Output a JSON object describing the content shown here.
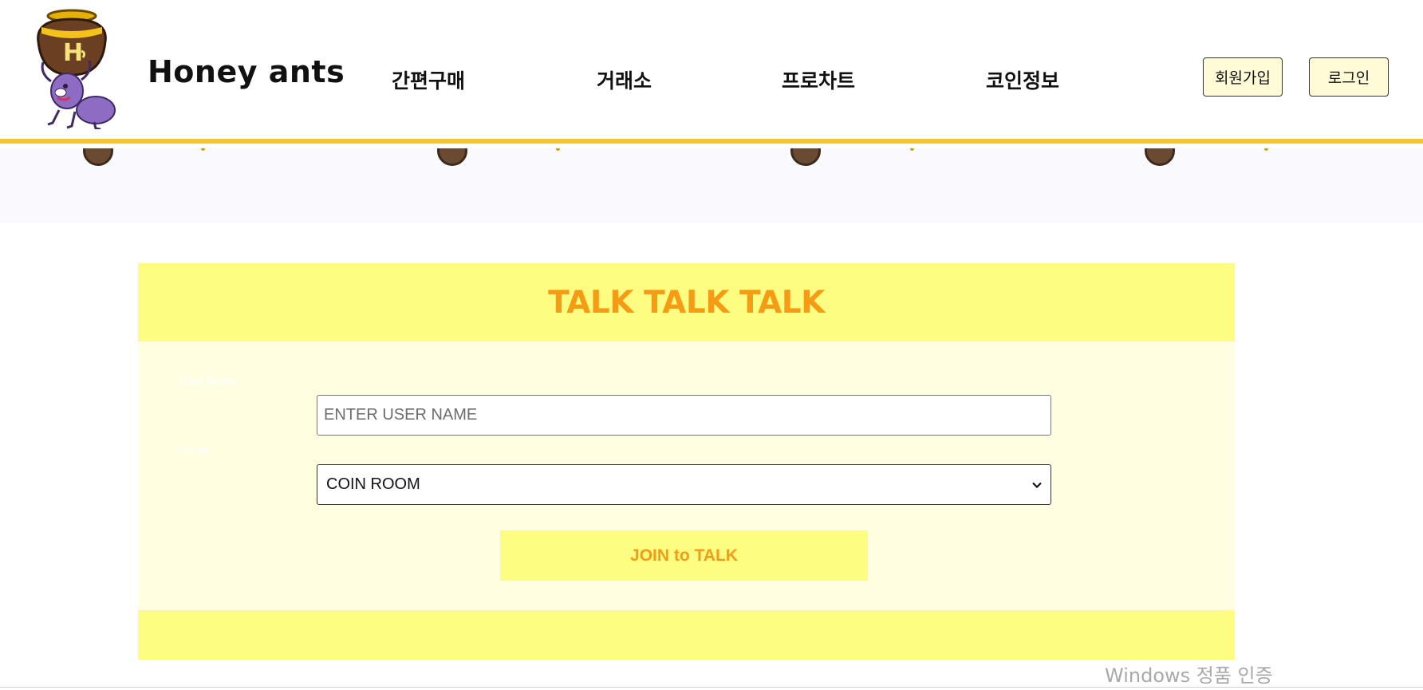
{
  "header": {
    "brand": "Honey ants",
    "nav": [
      {
        "label": "간편구매"
      },
      {
        "label": "거래소"
      },
      {
        "label": "프로차트"
      },
      {
        "label": "코인정보"
      }
    ],
    "signup_label": "회원가입",
    "login_label": "로그인"
  },
  "chat": {
    "title": "TALK TALK TALK",
    "username_label": "User Name",
    "username_placeholder": "ENTER USER NAME",
    "username_value": "",
    "room_label": "Room",
    "room_selected": "COIN ROOM",
    "join_label": "JOIN to TALK"
  },
  "watermark": {
    "text": "Windows 정품 인증"
  },
  "colors": {
    "accent_border": "#f7c52e",
    "card_header": "#fdfd82",
    "card_body": "#fffee0",
    "title_orange": "#f59b14"
  }
}
